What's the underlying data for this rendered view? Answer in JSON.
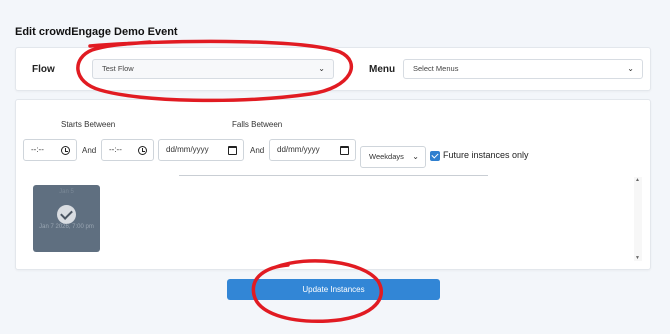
{
  "page": {
    "title": "Edit crowdEngage Demo Event"
  },
  "top_card": {
    "flow_label": "Flow",
    "flow_value": "Test Flow",
    "menu_label": "Menu",
    "menu_placeholder": "Select Menus"
  },
  "filters": {
    "starts_between_label": "Starts Between",
    "falls_between_label": "Falls Between",
    "time_from": "--:--",
    "time_to": "--:--",
    "and_1": "And",
    "and_2": "And",
    "date_from": "dd/mm/yyyy",
    "date_to": "dd/mm/yyyy",
    "weekdays_value": "Weekdays",
    "future_only_label": "Future instances only",
    "future_only_checked": true
  },
  "instances": [
    {
      "top_text": "Jan 5",
      "caption": "Jan 7 2026, 7:00 pm"
    }
  ],
  "actions": {
    "update_label": "Update Instances"
  },
  "colors": {
    "accent": "#3286d6",
    "annotation": "#e11b22"
  }
}
